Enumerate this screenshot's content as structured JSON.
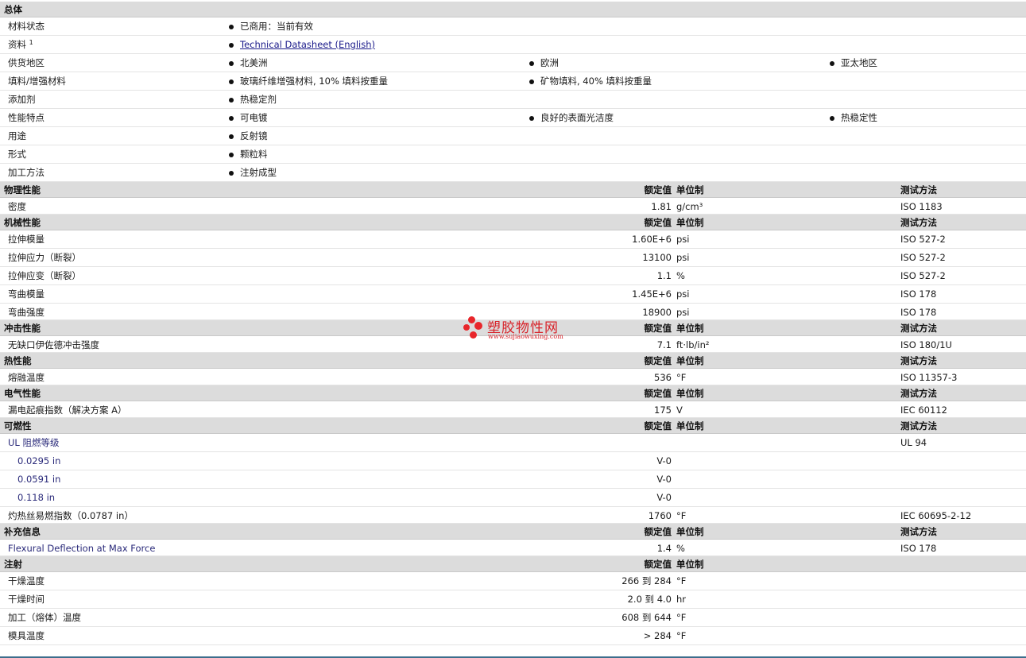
{
  "general": {
    "title": "总体",
    "rows": [
      {
        "label": "材料状态",
        "items": [
          "已商用：当前有效"
        ]
      },
      {
        "label": "资料",
        "sup": "1",
        "link": "Technical Datasheet (English)"
      },
      {
        "label": "供货地区",
        "items": [
          "北美洲",
          "欧洲",
          "亚太地区"
        ]
      },
      {
        "label": "填料/增强材料",
        "items": [
          "玻璃纤维增强材料, 10% 填料按重量",
          "矿物填料, 40% 填料按重量"
        ]
      },
      {
        "label": "添加剂",
        "items": [
          "热稳定剂"
        ]
      },
      {
        "label": "性能特点",
        "items": [
          "可电镀",
          "良好的表面光洁度",
          "热稳定性"
        ]
      },
      {
        "label": "用途",
        "items": [
          "反射镜"
        ]
      },
      {
        "label": "形式",
        "items": [
          "颗粒料"
        ]
      },
      {
        "label": "加工方法",
        "items": [
          "注射成型"
        ]
      }
    ]
  },
  "columns": {
    "value": "额定值",
    "unit": "单位制",
    "test": "测试方法"
  },
  "sections": {
    "physical": {
      "title": "物理性能",
      "rows": [
        {
          "label": "密度",
          "value": "1.81",
          "unit": "g/cm³",
          "test": "ISO 1183"
        }
      ]
    },
    "mechanical": {
      "title": "机械性能",
      "rows": [
        {
          "label": "拉伸模量",
          "value": "1.60E+6",
          "unit": "psi",
          "test": "ISO 527-2"
        },
        {
          "label": "拉伸应力（断裂）",
          "value": "13100",
          "unit": "psi",
          "test": "ISO 527-2"
        },
        {
          "label": "拉伸应变（断裂）",
          "value": "1.1",
          "unit": "%",
          "test": "ISO 527-2"
        },
        {
          "label": "弯曲模量",
          "value": "1.45E+6",
          "unit": "psi",
          "test": "ISO 178"
        },
        {
          "label": "弯曲强度",
          "value": "18900",
          "unit": "psi",
          "test": "ISO 178"
        }
      ]
    },
    "impact": {
      "title": "冲击性能",
      "rows": [
        {
          "label": "无缺口伊佐德冲击强度",
          "value": "7.1",
          "unit": "ft·lb/in²",
          "test": "ISO 180/1U"
        }
      ]
    },
    "thermal": {
      "title": "热性能",
      "rows": [
        {
          "label": "熔融温度",
          "value": "536",
          "unit": "°F",
          "test": "ISO 11357-3"
        }
      ]
    },
    "electrical": {
      "title": "电气性能",
      "rows": [
        {
          "label": "漏电起痕指数（解决方案 A）",
          "value": "175",
          "unit": "V",
          "test": "IEC 60112"
        }
      ]
    },
    "flammability": {
      "title": "可燃性",
      "ul": {
        "label": "UL 阻燃等级",
        "test": "UL 94"
      },
      "ul_rows": [
        {
          "thickness": "0.0295 in",
          "rating": "V-0"
        },
        {
          "thickness": "0.0591 in",
          "rating": "V-0"
        },
        {
          "thickness": "0.118 in",
          "rating": "V-0"
        }
      ],
      "gwfi": {
        "label": "灼热丝易燃指数（0.0787 in）",
        "value": "1760",
        "unit": "°F",
        "test": "IEC 60695-2-12"
      }
    },
    "supplemental": {
      "title": "补充信息",
      "rows": [
        {
          "label": "Flexural Deflection at Max Force",
          "value": "1.4",
          "unit": "%",
          "test": "ISO 178"
        }
      ]
    },
    "injection": {
      "title": "注射",
      "rows": [
        {
          "label": "干燥温度",
          "value": "266 到 284",
          "unit": "°F"
        },
        {
          "label": "干燥时间",
          "value": "2.0 到 4.0",
          "unit": "hr"
        },
        {
          "label": "加工（熔体）温度",
          "value": "608 到 644",
          "unit": "°F"
        },
        {
          "label": "模具温度",
          "value": "> 284",
          "unit": "°F"
        }
      ]
    }
  },
  "watermark": {
    "name": "塑胶物性网",
    "url": "www.sujiaowuxing.com"
  },
  "colors": {
    "header_bg": "#dcdcdc",
    "link": "#1a1a8a",
    "watermark": "#e8262b"
  }
}
